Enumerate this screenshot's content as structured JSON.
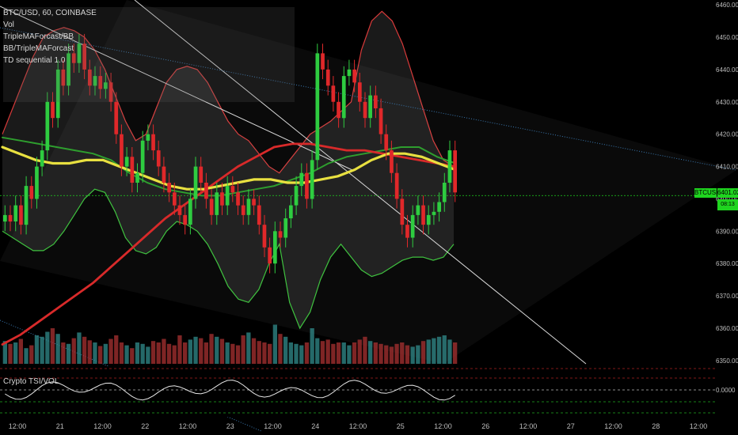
{
  "legend": {
    "symbol": "BTC/USD, 60, COINBASE",
    "items": [
      "Vol",
      "TripleMAForcast/BB",
      "BB/TripleMAForcast",
      "TD sequential 1.0"
    ]
  },
  "oscillator": {
    "label": "Crypto TSI/VOL",
    "zero_label": "0.0000"
  },
  "price_tag": {
    "symbol": "BTCUSD",
    "value": "6401.02",
    "sub": "08:13"
  },
  "colors": {
    "background": "#000000",
    "up_candle": "#2ecc40",
    "down_candle": "#e0282a",
    "bb_upper": "#d83a3a",
    "bb_lower": "#38c038",
    "ma_yellow": "#e8e040",
    "ma_red": "#d82a2a",
    "ma_green": "#2e9e2e",
    "trendline": "#d8d8d8",
    "dotted_line": "#3a78b0",
    "current_price_line": "#1fd41f"
  },
  "chart_data": {
    "type": "candlestick",
    "price_axis": {
      "ticks": [
        6350,
        6360,
        6370,
        6380,
        6390,
        6400,
        6410,
        6420,
        6430,
        6440,
        6450,
        6460
      ],
      "tick_labels": [
        "6350.00",
        "6360.00",
        "6370.00",
        "6380.00",
        "6390.00",
        "6400.00",
        "6410.00",
        "6420.00",
        "6430.00",
        "6440.00",
        "6450.00",
        "6460.00"
      ],
      "range": [
        6349,
        6461
      ]
    },
    "time_axis": {
      "labels": [
        "12:00",
        "21",
        "12:00",
        "22",
        "12:00",
        "23",
        "12:00",
        "24",
        "12:00",
        "25",
        "12:00",
        "26",
        "12:00",
        "27",
        "12:00",
        "28",
        "12:00"
      ],
      "range": [
        0,
        110
      ]
    },
    "current_price": 6401.02,
    "closes": [
      6395,
      6393,
      6398,
      6392,
      6404,
      6400,
      6410,
      6415,
      6430,
      6425,
      6440,
      6435,
      6445,
      6442,
      6448,
      6440,
      6435,
      6438,
      6434,
      6436,
      6430,
      6420,
      6410,
      6413,
      6405,
      6408,
      6418,
      6420,
      6415,
      6410,
      6405,
      6402,
      6398,
      6395,
      6392,
      6400,
      6410,
      6405,
      6400,
      6395,
      6402,
      6398,
      6404,
      6402,
      6398,
      6395,
      6400,
      6398,
      6392,
      6385,
      6380,
      6390,
      6388,
      6394,
      6398,
      6404,
      6408,
      6400,
      6412,
      6445,
      6440,
      6435,
      6430,
      6425,
      6438,
      6440,
      6436,
      6430,
      6425,
      6432,
      6428,
      6420,
      6415,
      6408,
      6400,
      6392,
      6388,
      6395,
      6398,
      6392,
      6395,
      6396,
      6399,
      6405,
      6415,
      6402
    ],
    "bb_upper": [
      6420,
      6428,
      6436,
      6444,
      6450,
      6452,
      6453,
      6452,
      6450,
      6446,
      6440,
      6432,
      6424,
      6418,
      6420,
      6428,
      6436,
      6440,
      6441,
      6440,
      6436,
      6430,
      6424,
      6420,
      6418,
      6414,
      6410,
      6408,
      6412,
      6416,
      6420,
      6422,
      6424,
      6427,
      6430,
      6446,
      6455,
      6458,
      6455,
      6448,
      6438,
      6428,
      6418,
      6412,
      6410
    ],
    "bb_lower": [
      6390,
      6388,
      6386,
      6384,
      6384,
      6386,
      6390,
      6395,
      6400,
      6403,
      6402,
      6396,
      6388,
      6384,
      6383,
      6385,
      6390,
      6393,
      6392,
      6390,
      6386,
      6380,
      6373,
      6369,
      6368,
      6372,
      6380,
      6386,
      6368,
      6360,
      6365,
      6375,
      6382,
      6386,
      6382,
      6378,
      6376,
      6377,
      6379,
      6381,
      6382,
      6382,
      6381,
      6382,
      6386
    ],
    "ma_yellow": [
      6416,
      6414,
      6412,
      6411,
      6411,
      6412,
      6412,
      6410,
      6408,
      6406,
      6404,
      6403,
      6403,
      6404,
      6405,
      6406,
      6406,
      6405,
      6405,
      6406,
      6407,
      6409,
      6412,
      6414,
      6414,
      6413,
      6411,
      6409
    ],
    "ma_red": [
      6355,
      6358,
      6362,
      6366,
      6370,
      6374,
      6379,
      6384,
      6389,
      6394,
      6398,
      6402,
      6406,
      6410,
      6413,
      6416,
      6417,
      6417,
      6416,
      6415,
      6415,
      6414,
      6413,
      6412,
      6411,
      6410
    ],
    "ma_green": [
      6419,
      6418,
      6417,
      6416,
      6415,
      6414,
      6412,
      6408,
      6405,
      6403,
      6402,
      6401,
      6401,
      6402,
      6403,
      6404,
      6406,
      6408,
      6411,
      6413,
      6414,
      6415,
      6416,
      6416,
      6413,
      6411
    ],
    "volume": [
      32,
      28,
      30,
      35,
      22,
      26,
      40,
      38,
      45,
      50,
      42,
      30,
      28,
      36,
      44,
      38,
      33,
      30,
      25,
      28,
      35,
      40,
      30,
      26,
      22,
      30,
      28,
      24,
      32,
      30,
      35,
      28,
      26,
      40,
      30,
      34,
      38,
      36,
      30,
      42,
      38,
      35,
      30,
      28,
      26,
      40,
      44,
      36,
      32,
      30,
      28,
      55,
      42,
      38,
      30,
      28,
      26,
      30,
      50,
      36,
      32,
      34,
      28,
      30,
      30,
      26,
      30,
      34,
      38,
      32,
      30,
      28,
      26,
      24,
      28,
      30,
      26,
      24,
      26,
      32,
      34,
      36,
      38,
      40,
      34,
      30
    ]
  }
}
